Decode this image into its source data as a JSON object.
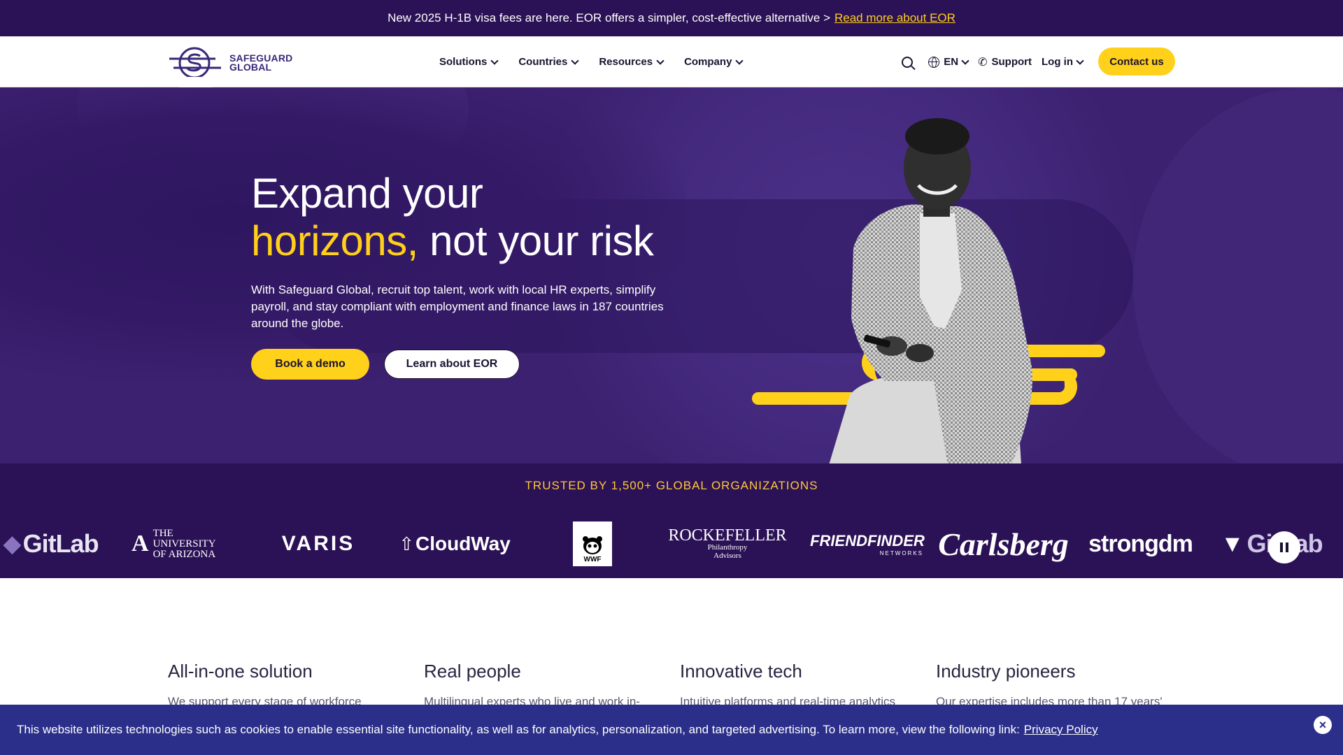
{
  "announcement": {
    "text": "New 2025 H-1B visa fees are here. EOR offers a simpler, cost-effective alternative >",
    "link": "Read more about EOR"
  },
  "header": {
    "logo_line1": "SAFEGUARD",
    "logo_line2": "GLOBAL",
    "nav": [
      {
        "label": "Solutions"
      },
      {
        "label": "Countries"
      },
      {
        "label": "Resources"
      },
      {
        "label": "Company"
      }
    ],
    "language": "EN",
    "support": "Support",
    "login": "Log in",
    "contact": "Contact us"
  },
  "hero": {
    "title_line1": "Expand your",
    "title_accent": "horizons,",
    "title_rest": "not your risk",
    "description": "With Safeguard Global, recruit top talent, work with local HR experts, simplify payroll, and stay compliant with employment and finance laws in 187 countries around the globe.",
    "primary_button": "Book a demo",
    "secondary_button": "Learn about EOR"
  },
  "trusted": {
    "label": "TRUSTED BY 1,500+ GLOBAL ORGANIZATIONS",
    "logos": {
      "gitlab": "GitLab",
      "uofa_line1": "The University",
      "uofa_line2": "of Arizona",
      "varis": "VARIS",
      "cloudway": "CloudWay",
      "wwf": "WWF",
      "rockefeller": "ROCKEFELLER",
      "rockefeller_sub1": "Philanthropy",
      "rockefeller_sub2": "Advisors",
      "friendfinder": "FRIENDFINDER",
      "friendfinder_sub": "NETWORKS",
      "carlsberg": "Carlsberg",
      "strongdm": "strongdm",
      "gitlab2": "GitLab"
    }
  },
  "features": [
    {
      "title": "All-in-one solution",
      "text": "We support every stage of workforce"
    },
    {
      "title": "Real people",
      "text": "Multilingual experts who live and work in-"
    },
    {
      "title": "Innovative tech",
      "text": "Intuitive platforms and real-time analytics"
    },
    {
      "title": "Industry pioneers",
      "text": "Our expertise includes more than 17 years'"
    }
  ],
  "cookie": {
    "text": "This website utilizes technologies such as cookies to enable essential site functionality, as well as for analytics, personalization, and targeted advertising. To learn more, view the following link:",
    "link": "Privacy Policy",
    "close": "×"
  },
  "colors": {
    "brand_purple": "#3c2170",
    "dark_purple": "#2b1155",
    "accent_yellow": "#ffd11a",
    "cookie_blue": "#2b2f8a"
  },
  "icons": [
    "search-icon",
    "globe-icon",
    "phone-icon",
    "chevron-down-icon",
    "pause-icon",
    "close-icon"
  ]
}
